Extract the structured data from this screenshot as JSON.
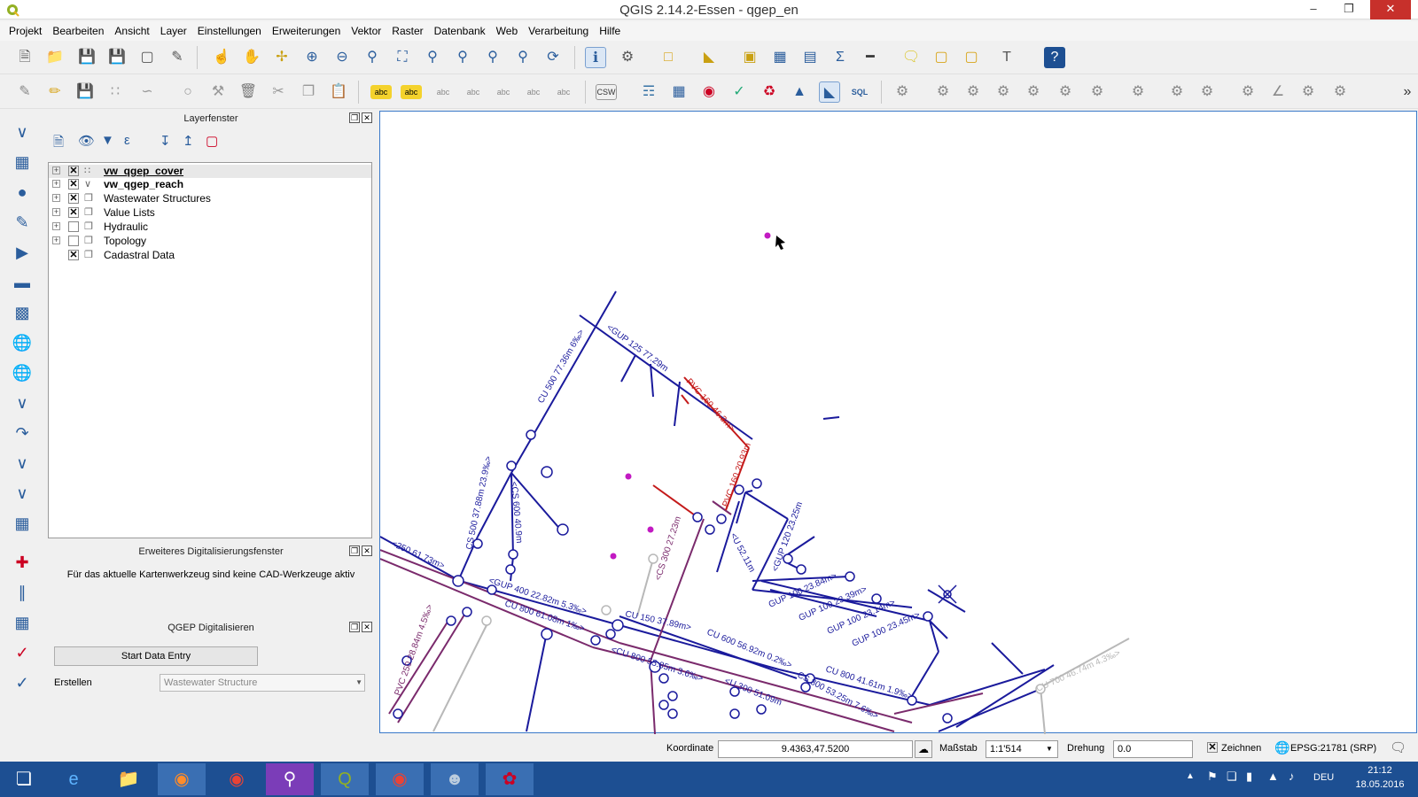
{
  "window": {
    "title": "QGIS 2.14.2-Essen - qgep_en"
  },
  "menu": [
    "Projekt",
    "Bearbeiten",
    "Ansicht",
    "Layer",
    "Einstellungen",
    "Erweiterungen",
    "Vektor",
    "Raster",
    "Datenbank",
    "Web",
    "Verarbeitung",
    "Hilfe"
  ],
  "toolbar": {
    "csw_label": "CSW",
    "sql_label": "SQL",
    "abc_label": "abc"
  },
  "layers_panel": {
    "title": "Layerfenster",
    "items": [
      {
        "label": "vw_qgep_cover",
        "checked": true,
        "bold": true
      },
      {
        "label": "vw_qgep_reach",
        "checked": true,
        "bold": true
      },
      {
        "label": "Wastewater Structures",
        "checked": true,
        "bold": false
      },
      {
        "label": "Value Lists",
        "checked": true,
        "bold": false
      },
      {
        "label": "Hydraulic",
        "checked": false,
        "bold": false
      },
      {
        "label": "Topology",
        "checked": false,
        "bold": false
      },
      {
        "label": "Cadastral Data",
        "checked": true,
        "bold": false
      }
    ]
  },
  "advanced_digitizing": {
    "title": "Erweiteres Digitalisierungsfenster",
    "message": "Für das aktuelle Kartenwerkzeug sind keine CAD-Werkzeuge aktiv"
  },
  "qgep_panel": {
    "title": "QGEP Digitalisieren",
    "start_button": "Start Data Entry",
    "create_label": "Erstellen",
    "create_value": "Wastewater Structure"
  },
  "map_labels": [
    "<GUP 125 77.29m",
    "CU 500 77.36m 6‰>",
    "PVC 160 46.3m>",
    "PVC 160 20.93m",
    "CS 500 37.88m 23.9‰>",
    "<CS 600 40.9m",
    "<CS 300 27.23m",
    "<U 52.11m",
    "<GUP 120 23.25m",
    "GUP 100 23.84m>",
    "GUP 100 23.39m>",
    "GUP 100 23.14m>",
    "GUP 100 23.45m>",
    "<GUP 400 22.82m 5.3‰>",
    "CU 800 61.08m 1‰>",
    "CU 150 37.89m>",
    "<CU 800 55.85m 3.6‰>",
    "CU 600 56.92m 0.2‰>",
    "<U 300 51.09m",
    "CS 800 53.25m 7.6‰>",
    "CU 800 41.61m 1.9‰>",
    "CU 700 46.74m 4.3‰>",
    "PVC 250 28.84m 4.5‰>",
    "<250 61.73m>"
  ],
  "statusbar": {
    "coord_label": "Koordinate",
    "coord_value": "9.4363,47.5200",
    "scale_label": "Maßstab",
    "scale_value": "1:1'514",
    "rotation_label": "Drehung",
    "rotation_value": "0.0",
    "render_label": "Zeichnen",
    "crs": "EPSG:21781 (SRP)"
  },
  "taskbar": {
    "lang": "DEU",
    "time": "21:12",
    "date": "18.05.2016"
  },
  "colors": {
    "sewer_blue": "#1a1a9c",
    "pressure_red": "#c41a1a",
    "combined_purple": "#7a2a6c",
    "node_magenta": "#c21ac2",
    "taskbar": "#1d4f92"
  }
}
